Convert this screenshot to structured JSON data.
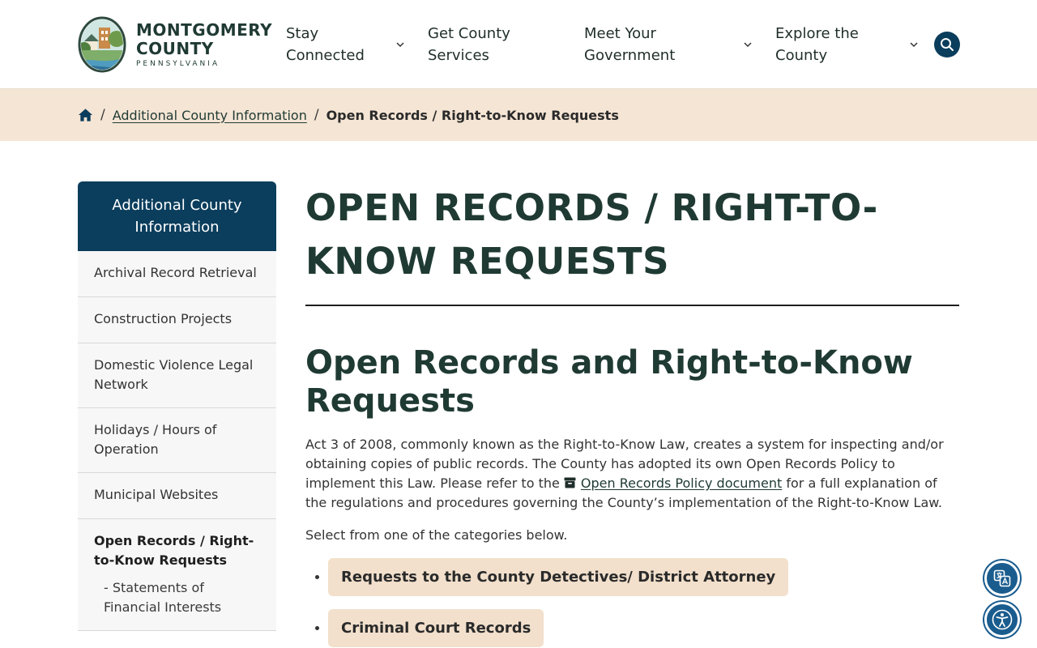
{
  "brand": {
    "line1": "MONTGOMERY",
    "line2": "COUNTY",
    "line3": "PENNSYLVANIA"
  },
  "nav": {
    "items": [
      {
        "label": "Stay Connected"
      },
      {
        "label": "Get County Services"
      },
      {
        "label": "Meet Your Government"
      },
      {
        "label": "Explore the County"
      }
    ]
  },
  "breadcrumb": {
    "parent": "Additional County Information",
    "separator": "/",
    "current": "Open Records / Right-to-Know Requests"
  },
  "sidebar": {
    "heading": "Additional County Information",
    "items": [
      {
        "label": "Archival Record Retrieval"
      },
      {
        "label": "Construction Projects"
      },
      {
        "label": "Domestic Violence Legal Network"
      },
      {
        "label": "Holidays / Hours of Operation"
      },
      {
        "label": "Municipal Websites"
      },
      {
        "label": "Open Records / Right-to-Know Requests"
      }
    ],
    "sub_item": "-  Statements of Financial Interests"
  },
  "main": {
    "title": "OPEN RECORDS / RIGHT-TO-KNOW REQUESTS",
    "subheading": "Open Records and Right-to-Know Requests",
    "intro_before": "Act 3 of 2008, commonly known as the Right-to-Know Law, creates a system for inspecting and/or obtaining copies of public records. The County has adopted its own Open Records Policy to implement this Law. Please refer to the ",
    "intro_link": "Open Records Policy document",
    "intro_after": " for a full explanation of the regulations and procedures governing the County’s implementation of the Right-to-Know Law.",
    "select_text": "Select from one of the categories below.",
    "categories": [
      {
        "label": "Requests to the County Detectives/ District Attorney"
      },
      {
        "label": "Criminal Court Records"
      }
    ]
  },
  "colors": {
    "navy": "#0b3d5c",
    "heading_green": "#1f3a33",
    "beige": "#f5e5d4",
    "button_beige": "#f2e0cc",
    "widget_blue": "#1a5c8e"
  },
  "icons": {
    "home": "home-icon",
    "search": "search-icon",
    "chevron": "chevron-down-icon",
    "document": "archive-icon",
    "translate": "translate-icon",
    "accessibility": "accessibility-icon"
  }
}
